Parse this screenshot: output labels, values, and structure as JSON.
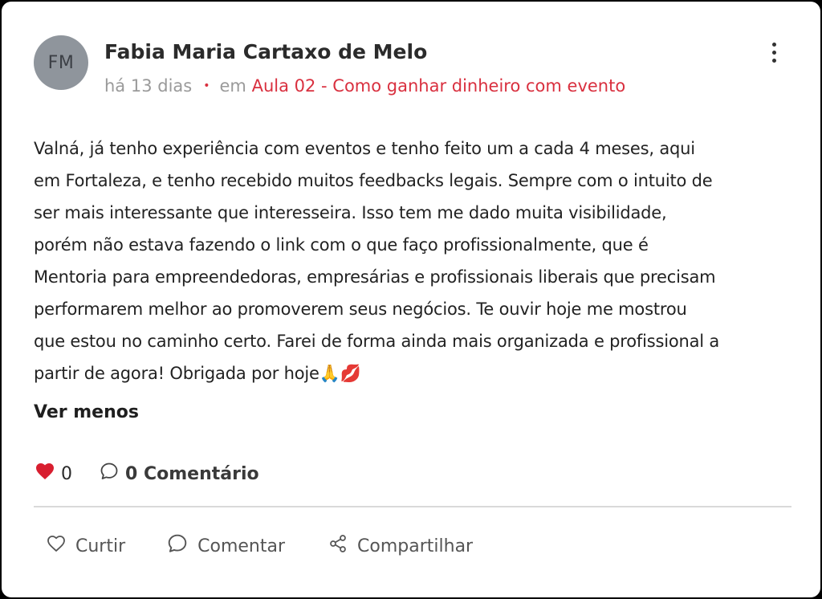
{
  "post": {
    "avatar_initials": "FM",
    "author": "Fabia Maria Cartaxo de Melo",
    "time": "há 13 dias",
    "separator": "•",
    "in_label": "em",
    "lesson": "Aula 02 - Como ganhar dinheiro com evento",
    "body_lines": [
      "Valná, já tenho experiência com eventos e tenho feito um a cada 4 meses, aqui",
      "em Fortaleza, e tenho recebido muitos feedbacks legais. Sempre com o intuito de",
      "ser mais interessante que interesseira. Isso tem me dado muita visibilidade,",
      "porém não estava fazendo o link com o que faço profissionalmente, que é",
      "Mentoria para empreendedoras, empresárias e profissionais liberais que precisam",
      "performarem melhor ao promoverem seus negócios. Te ouvir hoje me mostrou",
      "que estou no caminho certo. Farei de forma ainda mais organizada e profissional a",
      "partir de agora! Obrigada por hoje🙏💋"
    ],
    "see_less": "Ver menos",
    "like_count": "0",
    "comment_count": "0 Comentário"
  },
  "actions": {
    "like": "Curtir",
    "comment": "Comentar",
    "share": "Compartilhar"
  },
  "icons": {
    "more": "more-vertical-icon",
    "heart_filled": "heart-filled-icon",
    "comment": "comment-bubble-icon",
    "heart_outline": "heart-outline-icon",
    "share": "share-icon"
  },
  "colors": {
    "accent": "#d9303f",
    "heart": "#d81e2f",
    "avatar_bg": "#8f959c",
    "muted": "#9a9a9a"
  }
}
